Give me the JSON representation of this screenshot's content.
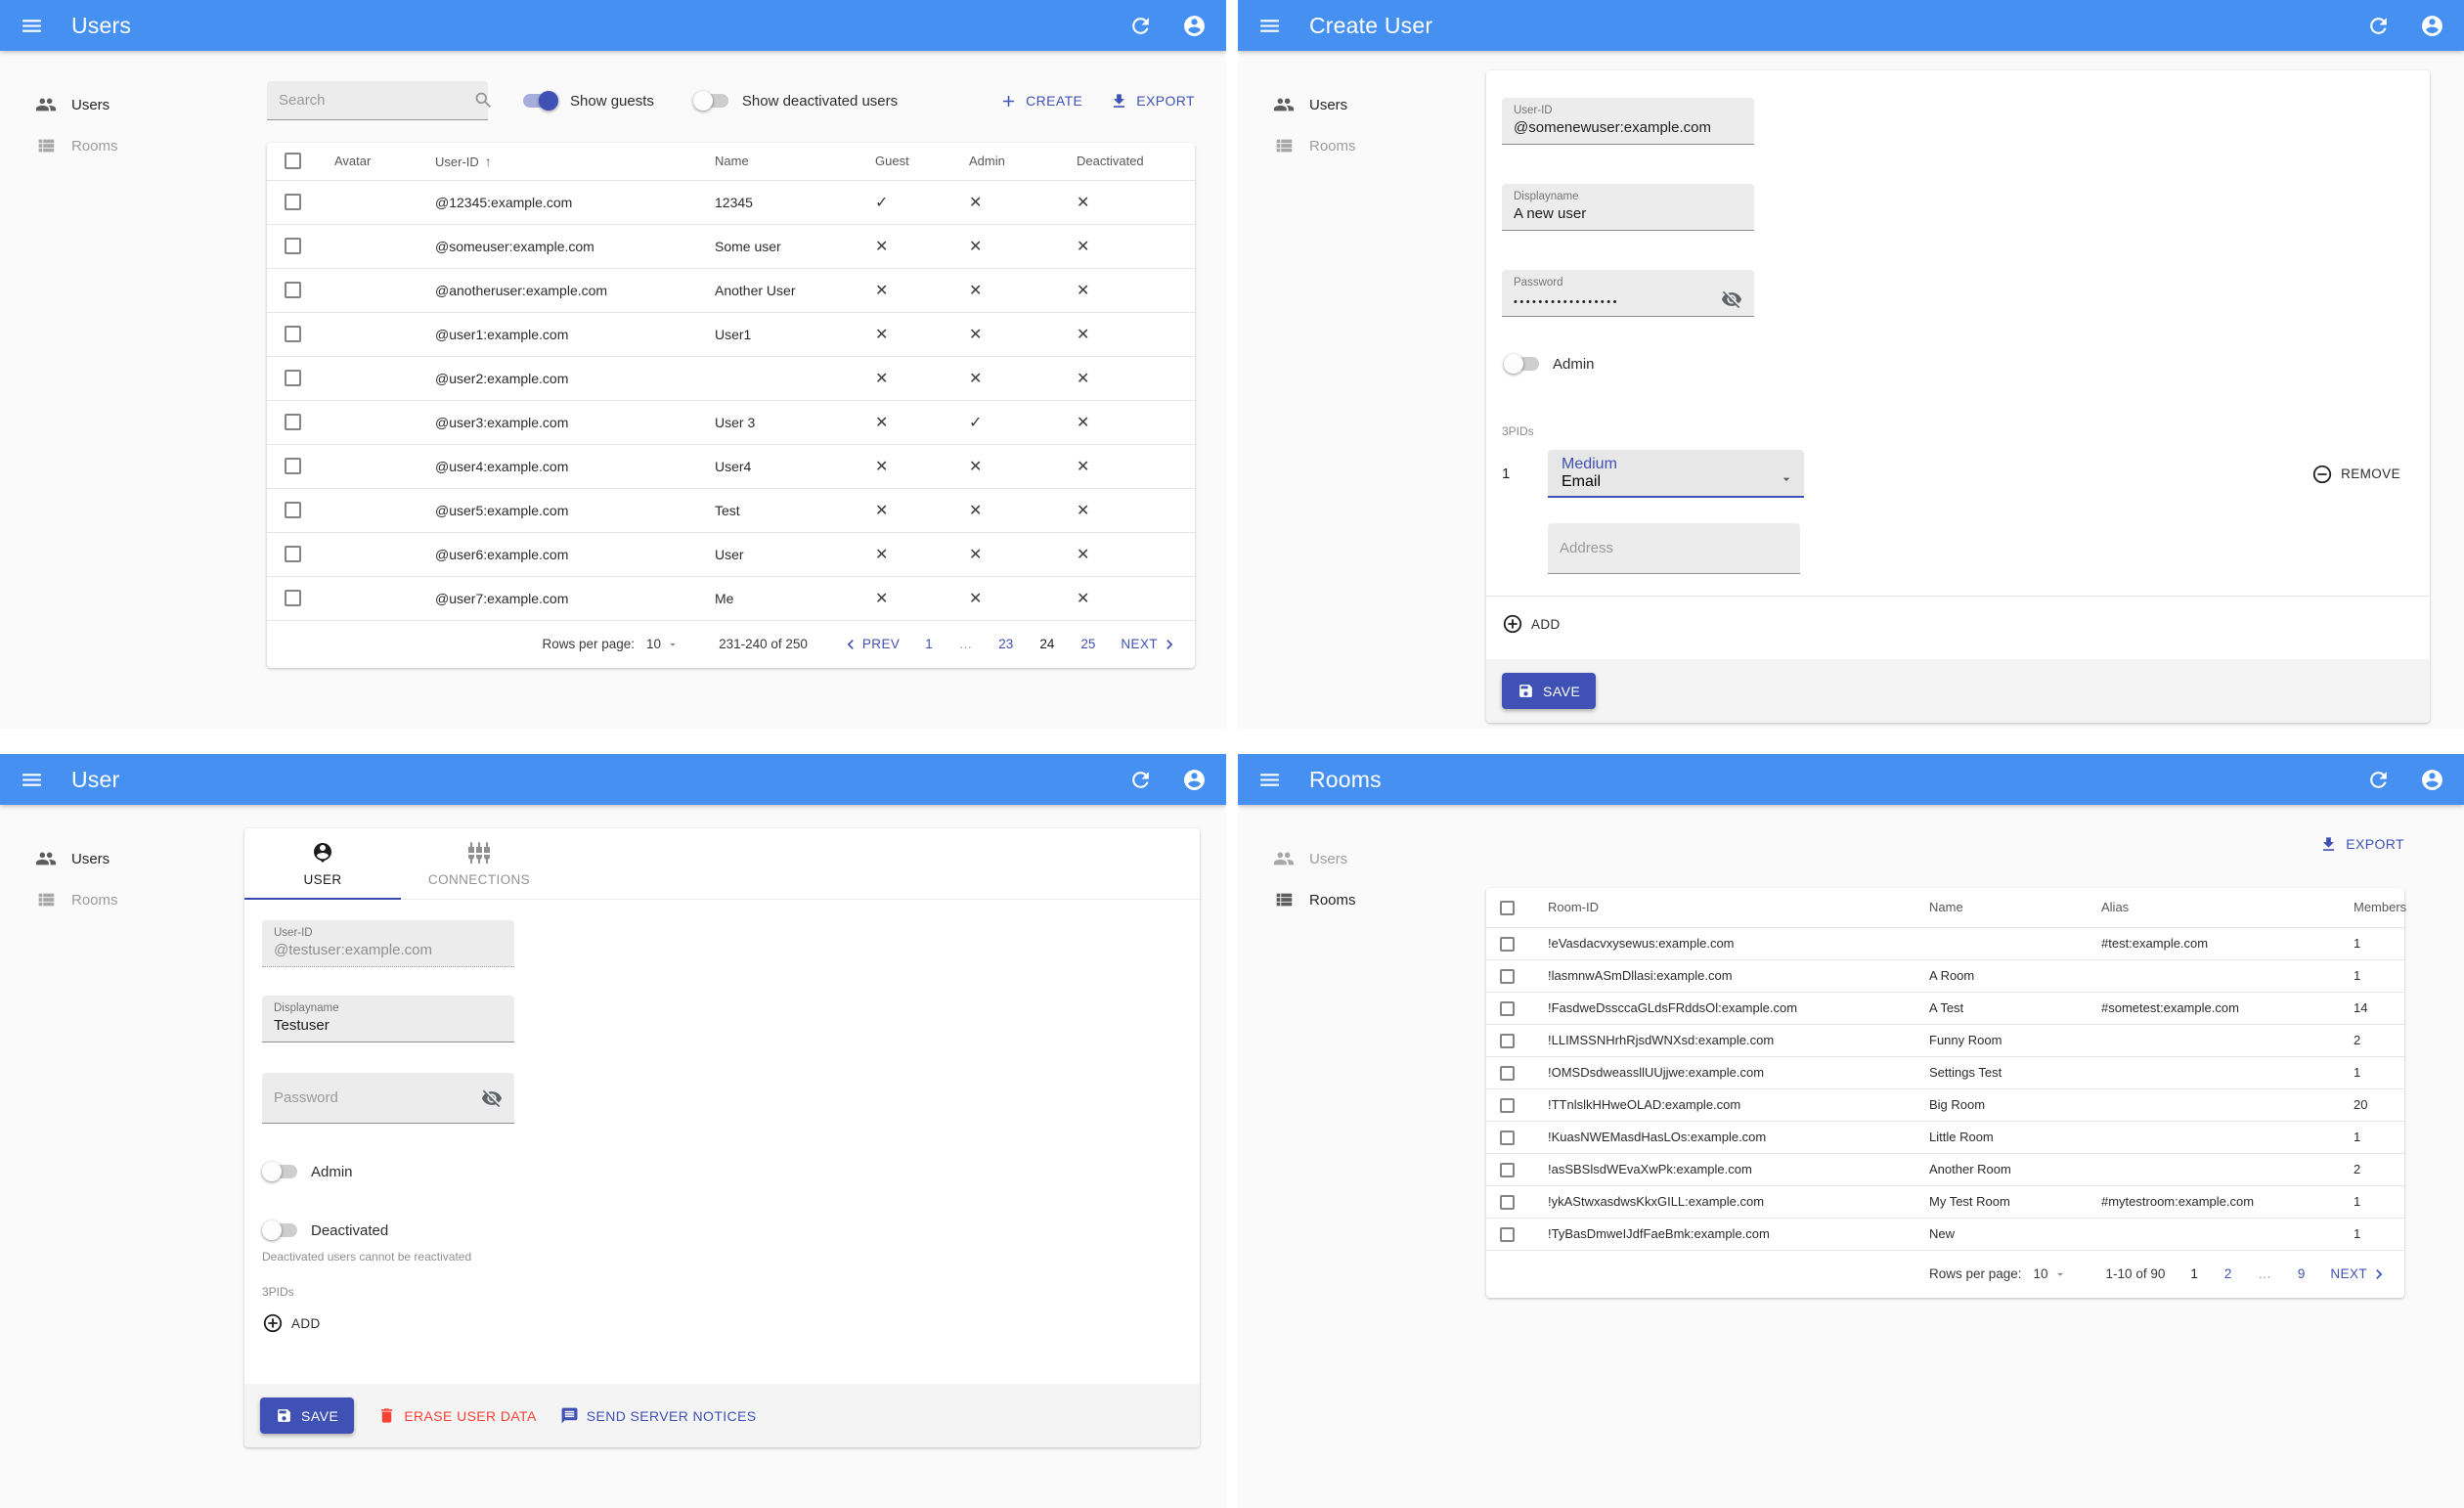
{
  "colors": {
    "appbar": "#4690f2",
    "primary": "#3f51b5",
    "danger": "#f44336"
  },
  "icons": {
    "check": "✓",
    "cross": "✕",
    "sort_asc": "↑",
    "ellipsis": "…"
  },
  "panels": {
    "users_list": {
      "appbar": {
        "title": "Users"
      },
      "sidebar": {
        "items": [
          {
            "label": "Users",
            "active": true
          },
          {
            "label": "Rooms",
            "active": false
          }
        ]
      },
      "toolbar": {
        "search_placeholder": "Search",
        "show_guests": {
          "label": "Show guests",
          "on": true
        },
        "show_deactivated": {
          "label": "Show deactivated users",
          "on": false
        },
        "create_label": "CREATE",
        "export_label": "EXPORT"
      },
      "table": {
        "headers": {
          "avatar": "Avatar",
          "user_id": "User-ID",
          "name": "Name",
          "guest": "Guest",
          "admin": "Admin",
          "deactivated": "Deactivated"
        },
        "rows": [
          {
            "user_id": "@12345:example.com",
            "name": "12345",
            "guest": true,
            "admin": false,
            "deactivated": false
          },
          {
            "user_id": "@someuser:example.com",
            "name": "Some user",
            "guest": false,
            "admin": false,
            "deactivated": false
          },
          {
            "user_id": "@anotheruser:example.com",
            "name": "Another User",
            "guest": false,
            "admin": false,
            "deactivated": false
          },
          {
            "user_id": "@user1:example.com",
            "name": "User1",
            "guest": false,
            "admin": false,
            "deactivated": false
          },
          {
            "user_id": "@user2:example.com",
            "name": "",
            "guest": false,
            "admin": false,
            "deactivated": false
          },
          {
            "user_id": "@user3:example.com",
            "name": "User 3",
            "guest": false,
            "admin": true,
            "deactivated": false
          },
          {
            "user_id": "@user4:example.com",
            "name": "User4",
            "guest": false,
            "admin": false,
            "deactivated": false
          },
          {
            "user_id": "@user5:example.com",
            "name": "Test",
            "guest": false,
            "admin": false,
            "deactivated": false
          },
          {
            "user_id": "@user6:example.com",
            "name": "User",
            "guest": false,
            "admin": false,
            "deactivated": false
          },
          {
            "user_id": "@user7:example.com",
            "name": "Me",
            "guest": false,
            "admin": false,
            "deactivated": false
          }
        ]
      },
      "pagination": {
        "rows_per_page_label": "Rows per page:",
        "rows_per_page": "10",
        "range": "231-240 of 250",
        "prev_label": "PREV",
        "next_label": "NEXT",
        "pages": [
          {
            "label": "1",
            "type": "link"
          },
          {
            "label": "…",
            "type": "ellipsis"
          },
          {
            "label": "23",
            "type": "link"
          },
          {
            "label": "24",
            "type": "current"
          },
          {
            "label": "25",
            "type": "link"
          }
        ]
      }
    },
    "create_user": {
      "appbar": {
        "title": "Create User"
      },
      "sidebar": {
        "items": [
          {
            "label": "Users",
            "active": true
          },
          {
            "label": "Rooms",
            "active": false
          }
        ]
      },
      "form": {
        "user_id": {
          "label": "User-ID",
          "value": "@somenewuser:example.com"
        },
        "displayname": {
          "label": "Displayname",
          "value": "A new user"
        },
        "password": {
          "label": "Password",
          "value": "•••••••••••••••••"
        },
        "admin_toggle": {
          "label": "Admin",
          "on": false
        },
        "pids_caption": "3PIDs",
        "pid": {
          "index": "1",
          "medium_label": "Medium",
          "medium_value": "Email",
          "address_placeholder": "Address",
          "remove_label": "REMOVE"
        },
        "add_label": "ADD",
        "save_label": "SAVE"
      }
    },
    "user_edit": {
      "appbar": {
        "title": "User"
      },
      "sidebar": {
        "items": [
          {
            "label": "Users",
            "active": true
          },
          {
            "label": "Rooms",
            "active": false
          }
        ]
      },
      "tabs": [
        {
          "label": "USER",
          "active": true
        },
        {
          "label": "CONNECTIONS",
          "active": false
        }
      ],
      "form": {
        "user_id": {
          "label": "User-ID",
          "value": "@testuser:example.com"
        },
        "displayname": {
          "label": "Displayname",
          "value": "Testuser"
        },
        "password": {
          "placeholder": "Password"
        },
        "admin_toggle": {
          "label": "Admin",
          "on": false
        },
        "deactivated_toggle": {
          "label": "Deactivated",
          "on": false
        },
        "deactivated_helper": "Deactivated users cannot be reactivated",
        "pids_caption": "3PIDs",
        "add_label": "ADD"
      },
      "footer": {
        "save_label": "SAVE",
        "erase_label": "ERASE USER DATA",
        "notices_label": "SEND SERVER NOTICES"
      }
    },
    "rooms_list": {
      "appbar": {
        "title": "Rooms"
      },
      "sidebar": {
        "items": [
          {
            "label": "Users",
            "active": false
          },
          {
            "label": "Rooms",
            "active": true
          }
        ]
      },
      "toolbar": {
        "export_label": "EXPORT"
      },
      "table": {
        "headers": {
          "room_id": "Room-ID",
          "name": "Name",
          "alias": "Alias",
          "members": "Members"
        },
        "rows": [
          {
            "room_id": "!eVasdacvxysewus:example.com",
            "name": "",
            "alias": "#test:example.com",
            "members": "1"
          },
          {
            "room_id": "!lasmnwASmDllasi:example.com",
            "name": "A Room",
            "alias": "",
            "members": "1"
          },
          {
            "room_id": "!FasdweDssccaGLdsFRddsOl:example.com",
            "name": "A Test",
            "alias": "#sometest:example.com",
            "members": "14"
          },
          {
            "room_id": "!LLIMSSNHrhRjsdWNXsd:example.com",
            "name": "Funny Room",
            "alias": "",
            "members": "2"
          },
          {
            "room_id": "!OMSDsdweassllUUjjwe:example.com",
            "name": "Settings Test",
            "alias": "",
            "members": "1"
          },
          {
            "room_id": "!TTnlslkHHweOLAD:example.com",
            "name": "Big Room",
            "alias": "",
            "members": "20"
          },
          {
            "room_id": "!KuasNWEMasdHasLOs:example.com",
            "name": "Little Room",
            "alias": "",
            "members": "1"
          },
          {
            "room_id": "!asSBSlsdWEvaXwPk:example.com",
            "name": "Another Room",
            "alias": "",
            "members": "2"
          },
          {
            "room_id": "!ykAStwxasdwsKkxGILL:example.com",
            "name": "My Test Room",
            "alias": "#mytestroom:example.com",
            "members": "1"
          },
          {
            "room_id": "!TyBasDmweIJdfFaeBmk:example.com",
            "name": "New",
            "alias": "",
            "members": "1"
          }
        ]
      },
      "pagination": {
        "rows_per_page_label": "Rows per page:",
        "rows_per_page": "10",
        "range": "1-10 of 90",
        "next_label": "NEXT",
        "pages": [
          {
            "label": "1",
            "type": "current"
          },
          {
            "label": "2",
            "type": "link"
          },
          {
            "label": "…",
            "type": "ellipsis"
          },
          {
            "label": "9",
            "type": "link"
          }
        ]
      }
    }
  }
}
